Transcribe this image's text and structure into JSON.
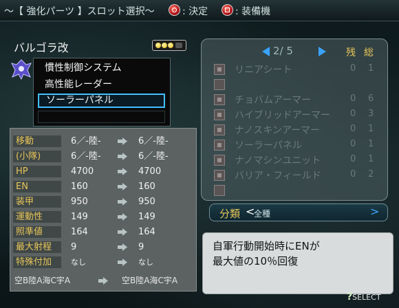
{
  "header": {
    "title": "～【 強化パーツ 】スロット選択～",
    "confirm_label": ": 決定",
    "equip_label": ": 装備機"
  },
  "unit": {
    "name": "バルゴラ改",
    "slots": [
      "慣性制御システム",
      "高性能レーダー",
      "ソーラーパネル",
      ""
    ]
  },
  "stats": [
    {
      "label": "移動",
      "before": "6／-陸-",
      "after": "6／-陸-"
    },
    {
      "label": "(小隊)",
      "before": "6／-陸-",
      "after": "6／-陸-"
    },
    {
      "label": "HP",
      "before": "4700",
      "after": "4700"
    },
    {
      "label": "EN",
      "before": "160",
      "after": "160"
    },
    {
      "label": "装甲",
      "before": "950",
      "after": "950"
    },
    {
      "label": "運動性",
      "before": "149",
      "after": "149"
    },
    {
      "label": "照準値",
      "before": "164",
      "after": "164"
    },
    {
      "label": "最大射程",
      "before": "9",
      "after": "9"
    },
    {
      "label": "特殊付加",
      "before": "なし",
      "after": "なし"
    }
  ],
  "terrain": {
    "before": "空B陸A海C宇A",
    "after": "空B陸A海C宇A"
  },
  "parts_panel": {
    "page": "2/ 5",
    "col_remaining": "残",
    "col_total": "総",
    "items": [
      {
        "name": "リニアシート",
        "remaining": "0",
        "total": "1"
      },
      {
        "name": "",
        "remaining": "",
        "total": ""
      },
      {
        "name": "チョバムアーマー",
        "remaining": "0",
        "total": "6"
      },
      {
        "name": "ハイブリッドアーマー",
        "remaining": "0",
        "total": "3"
      },
      {
        "name": "ナノスキンアーマー",
        "remaining": "0",
        "total": "1"
      },
      {
        "name": "ソーラーパネル",
        "remaining": "0",
        "total": "1"
      },
      {
        "name": "ナノマシンユニット",
        "remaining": "0",
        "total": "1"
      },
      {
        "name": "バリア・フィールド",
        "remaining": "0",
        "total": "2"
      },
      {
        "name": "",
        "remaining": "",
        "total": ""
      }
    ]
  },
  "category": {
    "label": "分類",
    "value": "全種"
  },
  "description": {
    "line1": "自軍行動開始時にENが",
    "line2": "最大値の10％回復"
  },
  "footer": {
    "select_label": "SELECT"
  },
  "colors": {
    "accent_blue": "#29b6ff",
    "label_gold": "#e8c65a"
  }
}
